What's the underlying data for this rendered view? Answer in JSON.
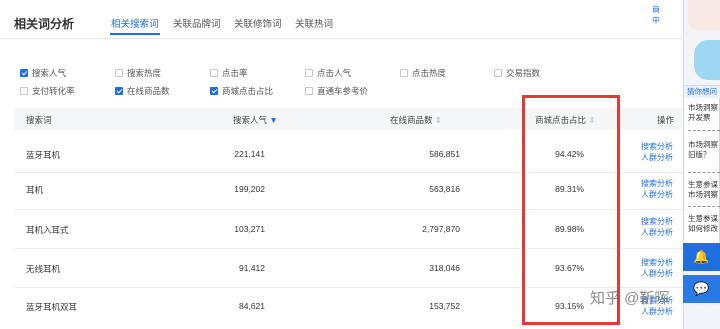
{
  "header": {
    "title": "相关词分析",
    "tabs": [
      "相关搜索词",
      "关联品牌词",
      "关联修饰词",
      "关联热词"
    ],
    "active_tab": "相关搜索词"
  },
  "filters": [
    {
      "label": "搜索人气",
      "checked": true
    },
    {
      "label": "搜索热度",
      "checked": false
    },
    {
      "label": "点击率",
      "checked": false
    },
    {
      "label": "点击人气",
      "checked": false
    },
    {
      "label": "点击热度",
      "checked": false
    },
    {
      "label": "交易指数",
      "checked": false
    },
    {
      "label": "支付转化率",
      "checked": false
    },
    {
      "label": "在线商品数",
      "checked": true
    },
    {
      "label": "商城点击占比",
      "checked": true
    },
    {
      "label": "直通车参考价",
      "checked": false
    }
  ],
  "table": {
    "columns": [
      "搜索词",
      "搜索人气",
      "在线商品数",
      "商城点击占比",
      "操作"
    ],
    "sort_icon": "sort-down-icon",
    "rows": [
      {
        "term": "蓝牙耳机",
        "popularity": "221,141",
        "items": "586,851",
        "ratio": "94.42%"
      },
      {
        "term": "耳机",
        "popularity": "199,202",
        "items": "563,816",
        "ratio": "89.31%"
      },
      {
        "term": "耳机入耳式",
        "popularity": "103,271",
        "items": "2,797,870",
        "ratio": "89.98%"
      },
      {
        "term": "无线耳机",
        "popularity": "91,412",
        "items": "318,046",
        "ratio": "93.67%"
      },
      {
        "term": "蓝牙耳机双耳",
        "popularity": "84,621",
        "items": "153,752",
        "ratio": "93.15%"
      }
    ],
    "op_links": [
      "搜索分析",
      "人群分析"
    ]
  },
  "right_panel": {
    "top_text": [
      "商",
      "中"
    ],
    "card_head": "猜你想问",
    "items": [
      [
        "市场洞察",
        "开发票"
      ],
      [
        "市场洞察",
        "旧版？"
      ],
      [
        "生意参谋",
        "市场洞察"
      ],
      [
        "生意参谋",
        "如何修改"
      ]
    ]
  },
  "watermark": "知乎 @靳晖",
  "colors": {
    "accent": "#1f6fe0",
    "highlight_box": "#e53935"
  }
}
